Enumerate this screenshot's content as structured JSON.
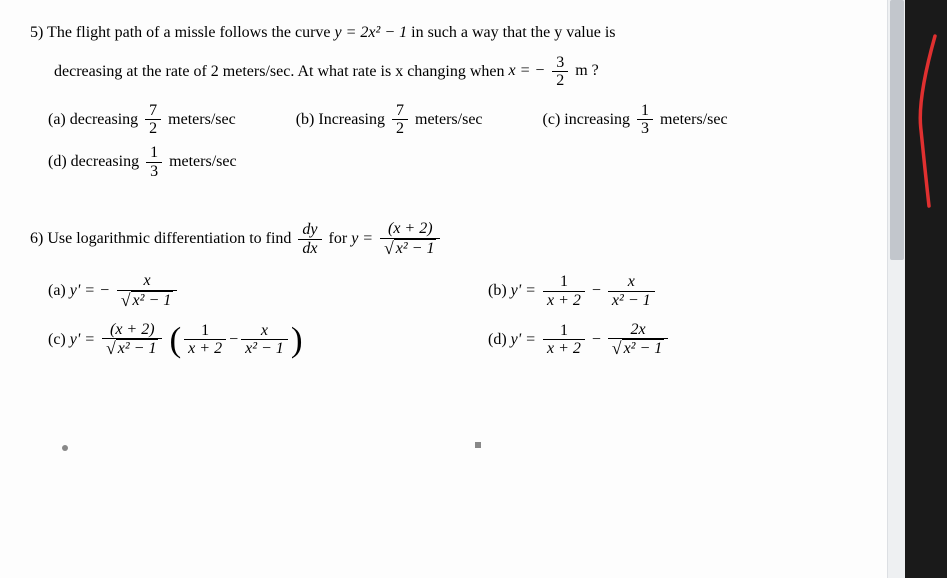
{
  "q5": {
    "number": "5)",
    "text_part1": "The flight path of a missle follows the curve",
    "equation1": "y = 2x² − 1",
    "text_part2": "in such a way that the y value is",
    "text_part3": "decreasing at the rate of 2 meters/sec.   At what rate is x changing when",
    "equation2_prefix": "x = −",
    "equation2_frac_num": "3",
    "equation2_frac_den": "2",
    "equation2_suffix": "m ?",
    "options": {
      "a": {
        "label": "(a)",
        "word": "decreasing",
        "frac_num": "7",
        "frac_den": "2",
        "unit": "meters/sec"
      },
      "b": {
        "label": "(b)",
        "word": "Increasing",
        "frac_num": "7",
        "frac_den": "2",
        "unit": "meters/sec"
      },
      "c": {
        "label": "(c)",
        "word": "increasing",
        "frac_num": "1",
        "frac_den": "3",
        "unit": "meters/sec"
      },
      "d": {
        "label": "(d)",
        "word": "decreasing",
        "frac_num": "1",
        "frac_den": "3",
        "unit": "meters/sec"
      }
    }
  },
  "q6": {
    "number": "6)",
    "text": "Use logarithmic differentiation to find",
    "dy": "dy",
    "dx": "dx",
    "for_text": "for",
    "y_eq": "y =",
    "rhs_num": "(x + 2)",
    "rhs_den_sqrt": "x² − 1",
    "options": {
      "a": {
        "label": "(a)",
        "prefix": "y' = −",
        "num": "x",
        "den_sqrt": "x² − 1"
      },
      "b": {
        "label": "(b)",
        "prefix": "y' =",
        "t1_num": "1",
        "t1_den": "x + 2",
        "minus": "−",
        "t2_num": "x",
        "t2_den": "x² − 1"
      },
      "c": {
        "label": "(c)",
        "prefix": "y' =",
        "front_num": "(x + 2)",
        "front_den_sqrt": "x² − 1",
        "t1_num": "1",
        "t1_den": "x + 2",
        "minus": "−",
        "t2_num": "x",
        "t2_den": "x² − 1"
      },
      "d": {
        "label": "(d)",
        "prefix": "y' =",
        "t1_num": "1",
        "t1_den": "x + 2",
        "minus": "−",
        "t2_num": "2x",
        "t2_den_sqrt": "x² − 1"
      }
    }
  }
}
